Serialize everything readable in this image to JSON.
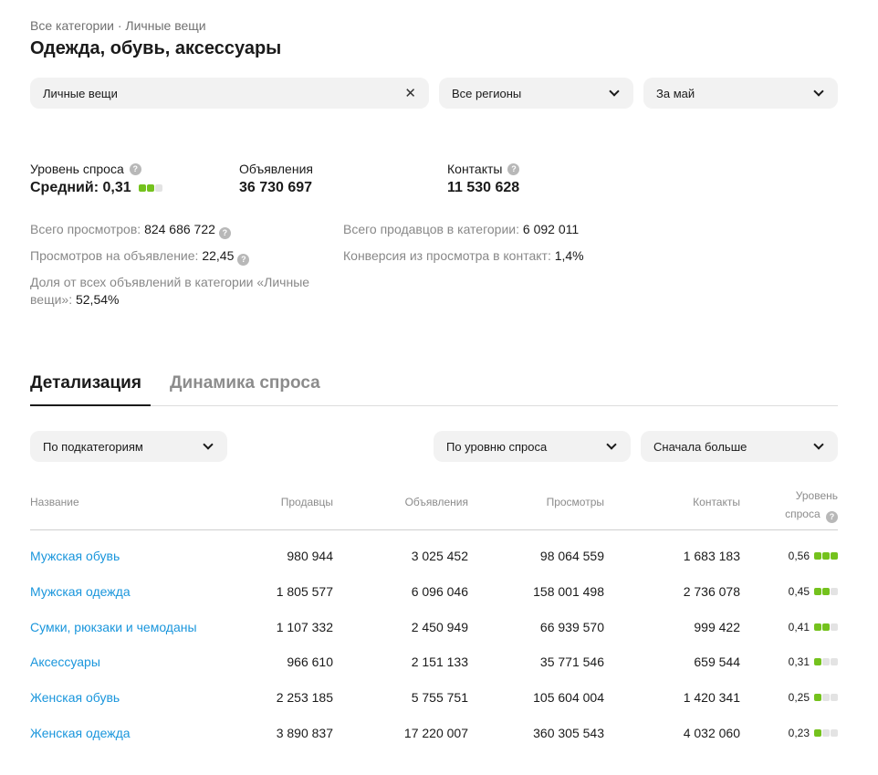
{
  "breadcrumb": {
    "text": "Все категории · Личные вещи"
  },
  "page_title": "Одежда, обувь, аксессуары",
  "filters": {
    "category": {
      "value": "Личные вещи"
    },
    "region": {
      "value": "Все регионы"
    },
    "period": {
      "value": "За май"
    }
  },
  "summary": {
    "demand": {
      "label": "Уровень спроса",
      "value": "Средний: 0,31",
      "level": 2
    },
    "listings": {
      "label": "Объявления",
      "value": "36 730 697"
    },
    "contacts": {
      "label": "Контакты",
      "value": "11 530 628"
    }
  },
  "metrics": {
    "total_views": {
      "label": "Всего просмотров:",
      "value": "824 686 722"
    },
    "views_per_listing": {
      "label": "Просмотров на объявление:",
      "value": "22,45"
    },
    "share_line1": "Доля от всех объявлений в категории «Личные",
    "share_line2": "вещи»:",
    "share_value": "52,54%",
    "total_sellers": {
      "label": "Всего продавцов в категории:",
      "value": "6 092 011"
    },
    "conversion": {
      "label": "Конверсия из просмотра в контакт:",
      "value": "1,4%"
    }
  },
  "tabs": {
    "details": "Детализация",
    "dynamics": "Динамика спроса"
  },
  "table_filters": {
    "group": {
      "value": "По подкатегориям"
    },
    "sort_by": {
      "value": "По уровню спроса"
    },
    "order": {
      "value": "Сначала больше"
    }
  },
  "table": {
    "headers": {
      "name": "Название",
      "sellers": "Продавцы",
      "listings": "Объявления",
      "views": "Просмотры",
      "contacts": "Контакты",
      "demand_line1": "Уровень",
      "demand_line2": "спроса"
    },
    "rows": [
      {
        "name": "Мужская обувь",
        "sellers": "980 944",
        "listings": "3 025 452",
        "views": "98 064 559",
        "contacts": "1 683 183",
        "demand": "0,56",
        "level": 3
      },
      {
        "name": "Мужская одежда",
        "sellers": "1 805 577",
        "listings": "6 096 046",
        "views": "158 001 498",
        "contacts": "2 736 078",
        "demand": "0,45",
        "level": 2
      },
      {
        "name": "Сумки, рюкзаки и чемоданы",
        "sellers": "1 107 332",
        "listings": "2 450 949",
        "views": "66 939 570",
        "contacts": "999 422",
        "demand": "0,41",
        "level": 2
      },
      {
        "name": "Аксессуары",
        "sellers": "966 610",
        "listings": "2 151 133",
        "views": "35 771 546",
        "contacts": "659 544",
        "demand": "0,31",
        "level": 1
      },
      {
        "name": "Женская обувь",
        "sellers": "2 253 185",
        "listings": "5 755 751",
        "views": "105 604 004",
        "contacts": "1 420 341",
        "demand": "0,25",
        "level": 1
      },
      {
        "name": "Женская одежда",
        "sellers": "3 890 837",
        "listings": "17 220 007",
        "views": "360 305 543",
        "contacts": "4 032 060",
        "demand": "0,23",
        "level": 1
      }
    ]
  },
  "colors": {
    "link": "#1a96dc",
    "level_on": "#74c21d",
    "level_off": "#e3e3e3"
  }
}
